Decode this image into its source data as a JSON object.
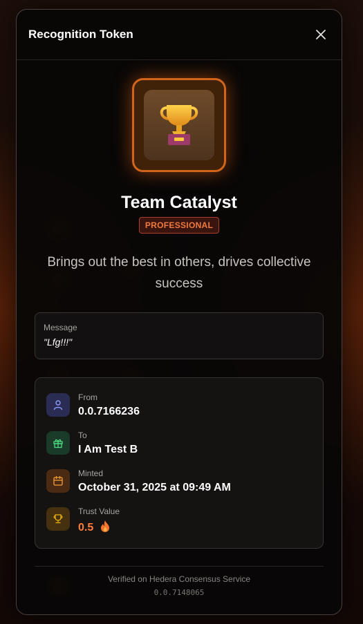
{
  "modal": {
    "title": "Recognition Token",
    "close_icon": "close-icon"
  },
  "badge": {
    "icon": "trophy-icon",
    "name": "Team Catalyst",
    "category": "PROFESSIONAL",
    "description": "Brings out the best in others, drives collective success"
  },
  "message": {
    "label": "Message",
    "text": "\"Lfg!!!\""
  },
  "details": [
    {
      "label": "From",
      "value": "0.0.7166236",
      "icon": "user-icon",
      "color": "#8a9cf5"
    },
    {
      "label": "To",
      "value": "I Am Test B",
      "icon": "gift-icon",
      "color": "#4ade80"
    },
    {
      "label": "Minted",
      "value": "October 31, 2025 at 09:49 AM",
      "icon": "calendar-icon",
      "color": "#f59e3a"
    },
    {
      "label": "Trust Value",
      "value": "0.5",
      "icon": "trophy-icon",
      "color": "#eab308"
    }
  ],
  "footer": {
    "verified": "Verified on Hedera Consensus Service",
    "topic_id": "0.0.7148065"
  },
  "colors": {
    "accent": "#d2651c",
    "tag_text": "#f07a3c",
    "trust_value": "#ff7f3a"
  }
}
